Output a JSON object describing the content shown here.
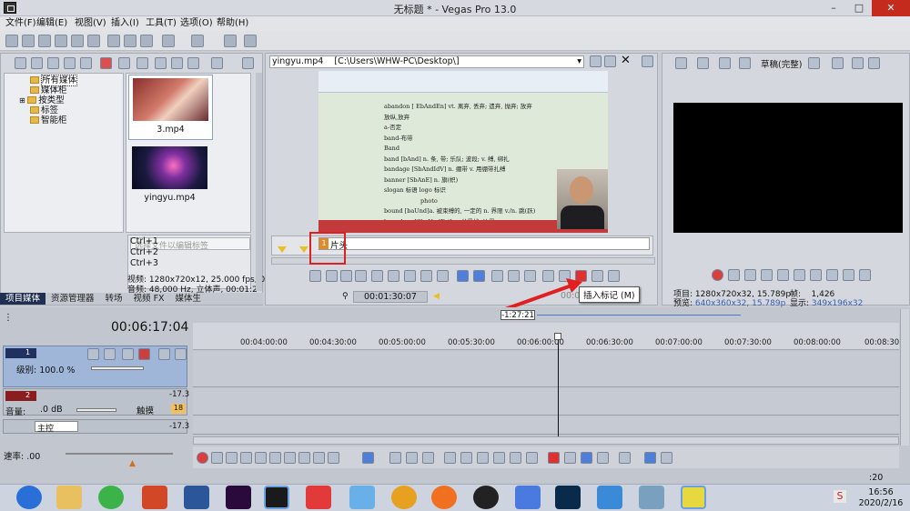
{
  "window": {
    "title": "无标题 * - Vegas Pro 13.0",
    "minimize": "–",
    "maximize": "□",
    "close": "✕"
  },
  "menu": [
    "文件(F)",
    "编辑(E)",
    "视图(V)",
    "插入(I)",
    "工具(T)",
    "选项(O)",
    "帮助(H)"
  ],
  "explorer": {
    "tree": [
      "所有媒体",
      "媒体柜",
      "按类型",
      "标签",
      "智能柜"
    ],
    "media": [
      {
        "name": "3.mp4"
      },
      {
        "name": "yingyu.mp4"
      }
    ],
    "search_placeholder": "选择文件以编辑标签",
    "shortcuts": [
      "Ctrl+1",
      "Ctrl+2",
      "Ctrl+3"
    ],
    "video_info": "视频: 1280x720x12, 25.000 fps, 0(",
    "audio_info": "音频: 48,000 Hz, 立体声, 00:01:2",
    "tabs": [
      "项目媒体",
      "资源管理器",
      "转场",
      "视频 FX",
      "媒体生"
    ]
  },
  "trimmer": {
    "file": "yingyu.mp4",
    "path": "[C:\\Users\\WHW-PC\\Desktop\\]",
    "region_index": "1",
    "region_label": "片头",
    "time_in": "00:01:30:07",
    "time_dim": "00:00:49:15",
    "tooltip": "插入标记 (M)",
    "doc_lines": [
      "abandon [ EbAndEn]  vt. 离弃, 丢弃; 遗弃, 抛弃; 放弃",
      "放纵,放弃",
      "a-否定",
      "band-布带",
      "Band",
      "band [bAnd]   n. 条, 带; 乐队; 波段; v. 缚, 绑扎",
      "bandage [SbAndIdV]   n. 绷带 v. 用绷带扎缚",
      "banner  [SbAnE]  n. 旗(帜)",
      "slogan  标语  logo  标识",
      "photo",
      "bound  [baUnd]a. 被束缚的, 一定的  n. 界限 v./n. 跳(跃)",
      "boundary [SbaUndEri]  n. 分界线, 边界"
    ]
  },
  "preview": {
    "quality": "草稿(完整)",
    "project_label": "项目:",
    "project": "1280x720x32, 15.789p",
    "preview_label": "预览:",
    "preview": "640x360x32, 15.789p",
    "frame_label": "帧:",
    "frame": "1,426",
    "display_label": "显示:",
    "display": "349x196x32"
  },
  "timeline": {
    "timecode": "00:06:17:04",
    "region_badge": "-1:27:21",
    "ruler": [
      "00:04:00:00",
      "00:04:30:00",
      "00:05:00:00",
      "00:05:30:00",
      "00:06:00:00",
      "00:06:30:00",
      "00:07:00:00",
      "00:07:30:00",
      "00:08:00:00",
      "00:08:30"
    ],
    "video_track": {
      "number": "1",
      "level": "级别: 100.0 %"
    },
    "audio_track": {
      "number": "2",
      "volume": "音量:",
      "volume_value": ".0 dB",
      "mode": "触摸",
      "meter": "-17.3",
      "count": "18"
    },
    "master": {
      "name": "主控",
      "meter": "-17.3"
    },
    "rate": "速率: .00",
    "end_value": ":20"
  },
  "taskbar": {
    "time": "16:56",
    "date": "2020/2/16",
    "ime": "S"
  },
  "colors": {
    "accent_red": "#e02020",
    "region_orange": "#e08a2a",
    "dark": "#203050"
  }
}
